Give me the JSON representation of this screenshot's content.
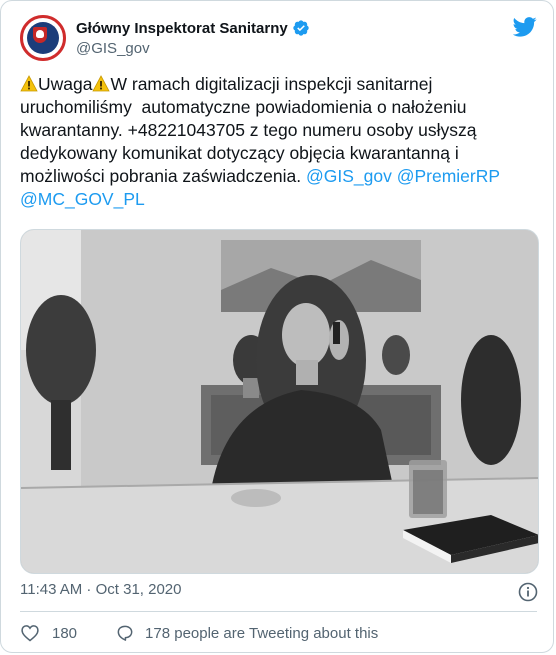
{
  "tweet": {
    "author_name": "Główny Inspektorat Sanitarny",
    "author_handle": "@GIS_gov",
    "verified_icon": "verified-badge-icon",
    "platform_icon": "twitter-bird-icon",
    "text_segments": {
      "warn_icon": "warning-icon",
      "uwaga": "Uwaga",
      "body": "W ramach digitalizacji inspekcji sanitarnej uruchomiliśmy  automatyczne powiadomienia o nałożeniu kwarantanny. +48221043705 z tego numeru osoby usłyszą dedykowany komunikat dotyczący objęcia kwarantanną i możliwości pobrania zaświadczenia. ",
      "mention_1": "@GIS_gov",
      "mention_2": "@PremierRP",
      "mention_3": "@MC_GOV_PL"
    },
    "photo_icon": "woman-on-phone-photo",
    "timestamp": "11:43 AM · Oct 31, 2020",
    "like_count": "180",
    "reply_text": "178 people are Tweeting about this"
  },
  "colors": {
    "link": "#1d9bf0",
    "muted": "#536471",
    "border": "#cfd9de",
    "brand": "#1d9bf0"
  }
}
